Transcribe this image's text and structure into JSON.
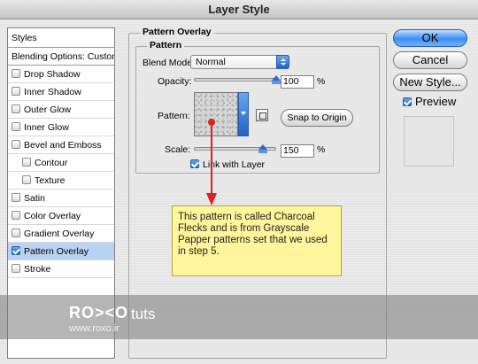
{
  "window": {
    "title": "Layer Style"
  },
  "styles_panel": {
    "header": "Styles",
    "blending_options": "Blending Options: Custom",
    "items": [
      {
        "label": "Drop Shadow",
        "checked": false,
        "indent": false
      },
      {
        "label": "Inner Shadow",
        "checked": false,
        "indent": false
      },
      {
        "label": "Outer Glow",
        "checked": false,
        "indent": false
      },
      {
        "label": "Inner Glow",
        "checked": false,
        "indent": false
      },
      {
        "label": "Bevel and Emboss",
        "checked": false,
        "indent": false
      },
      {
        "label": "Contour",
        "checked": false,
        "indent": true
      },
      {
        "label": "Texture",
        "checked": false,
        "indent": true
      },
      {
        "label": "Satin",
        "checked": false,
        "indent": false
      },
      {
        "label": "Color Overlay",
        "checked": false,
        "indent": false
      },
      {
        "label": "Gradient Overlay",
        "checked": false,
        "indent": false
      },
      {
        "label": "Pattern Overlay",
        "checked": true,
        "indent": false,
        "selected": true
      },
      {
        "label": "Stroke",
        "checked": false,
        "indent": false
      }
    ]
  },
  "pattern_overlay": {
    "group_title": "Pattern Overlay",
    "subgroup_title": "Pattern",
    "blend_mode_label": "Blend Mode:",
    "blend_mode_value": "Normal",
    "opacity_label": "Opacity:",
    "opacity_value": "100",
    "opacity_percent": 100,
    "pattern_label": "Pattern:",
    "snap_button": "Snap to Origin",
    "scale_label": "Scale:",
    "scale_value": "150",
    "scale_percent": 150,
    "percent_sign": "%",
    "link_label": "Link with Layer",
    "link_checked": true
  },
  "buttons": {
    "ok": "OK",
    "cancel": "Cancel",
    "new_style": "New Style...",
    "preview_label": "Preview",
    "preview_checked": true
  },
  "annotation": {
    "text": "This pattern is called Charcoal Flecks and is from Grayscale Papper patterns set that we used in step 5.",
    "arrow_color": "#e02020"
  },
  "watermark": {
    "logo": "RO><O",
    "tuts": "tuts",
    "url": "www.roxo.ir"
  },
  "colors": {
    "accent": "#3e8ef2",
    "note_bg": "#fff59b",
    "selection": "#b9d2f1"
  }
}
